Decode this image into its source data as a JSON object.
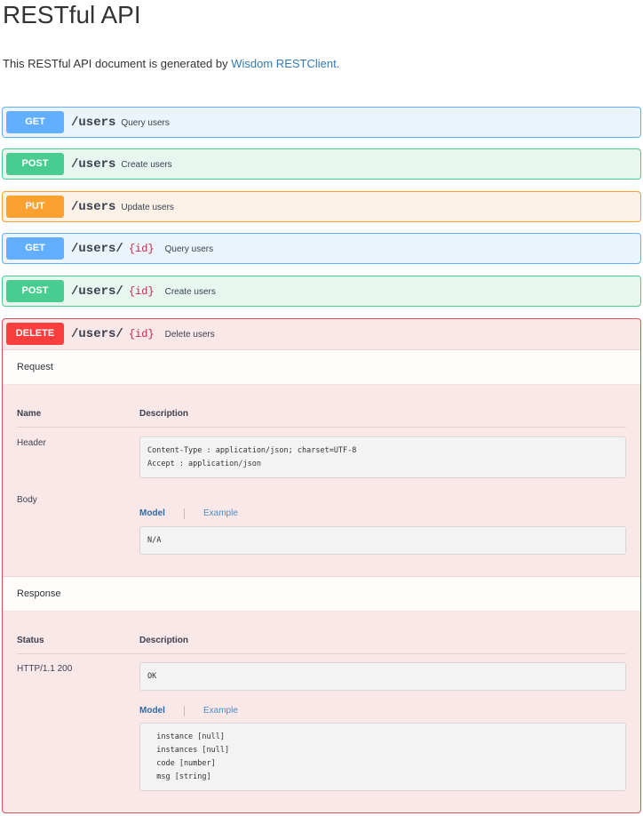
{
  "page": {
    "title": "RESTful API",
    "intro_text": "This RESTful API document is generated by ",
    "intro_link": "Wisdom RESTClient."
  },
  "colors": {
    "get": "#61affe",
    "post": "#49cc90",
    "put": "#fca130",
    "delete": "#f93e3e",
    "link": "#337ab7"
  },
  "operations": [
    {
      "method": "GET",
      "path": "/users",
      "param": "",
      "summary": "Query users"
    },
    {
      "method": "POST",
      "path": "/users",
      "param": "",
      "summary": "Create users"
    },
    {
      "method": "PUT",
      "path": "/users",
      "param": "",
      "summary": "Update users"
    },
    {
      "method": "GET",
      "path": "/users/",
      "param": "{id}",
      "summary": "Query users"
    },
    {
      "method": "POST",
      "path": "/users/",
      "param": "{id}",
      "summary": "Create users"
    },
    {
      "method": "DELETE",
      "path": "/users/",
      "param": "{id}",
      "summary": "Delete users"
    }
  ],
  "expanded": {
    "request": {
      "heading": "Request",
      "col_name": "Name",
      "col_description": "Description",
      "header_label": "Header",
      "header_value": "Content-Type : application/json; charset=UTF-8\nAccept : application/json",
      "body_label": "Body",
      "tab_model": "Model",
      "tab_example": "Example",
      "body_value": "N/A"
    },
    "response": {
      "heading": "Response",
      "col_status": "Status",
      "col_description": "Description",
      "status_value": "HTTP/1.1 200",
      "description_value": "OK",
      "tab_model": "Model",
      "tab_example": "Example",
      "model_value": "  instance [null]\n  instances [null]\n  code [number]\n  msg [string]"
    }
  }
}
